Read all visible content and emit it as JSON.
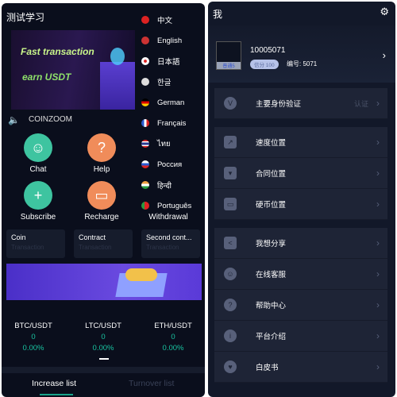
{
  "left": {
    "title": "测试学习",
    "banner": {
      "line1": "Fast transaction",
      "line2": "earn  USDT"
    },
    "notice": "COINZOOM",
    "functions": [
      {
        "label": "Chat",
        "icon": "headset-icon",
        "color": "#3ec4a0"
      },
      {
        "label": "Help",
        "icon": "question-icon",
        "color": "#f08c5a"
      },
      {
        "label": "Subscribe",
        "icon": "document-plus-icon",
        "color": "#3ec4a0"
      },
      {
        "label": "Recharge",
        "icon": "wallet-icon",
        "color": "#f08c5a"
      },
      {
        "label": "Withdrawal"
      }
    ],
    "languages": [
      {
        "label": "中文",
        "color": "#d22"
      },
      {
        "label": "English",
        "color": "#c33"
      },
      {
        "label": "日本語",
        "color": "#fff"
      },
      {
        "label": "한글",
        "color": "#ddd"
      },
      {
        "label": "German",
        "color": "#e8a000"
      },
      {
        "label": "Français",
        "color": "#2a5bd0"
      },
      {
        "label": "ไทย",
        "color": "#2a3b90"
      },
      {
        "label": "Россия",
        "color": "#2a5bd0"
      },
      {
        "label": "हिन्दी",
        "color": "#f0a040"
      },
      {
        "label": "Português",
        "color": "#2a9b40"
      }
    ],
    "cards": [
      {
        "title": "Coin",
        "sub": "Transaction"
      },
      {
        "title": "Contract",
        "sub": "Transaction"
      },
      {
        "title": "Second cont...",
        "sub": "Transaction"
      }
    ],
    "tickers": [
      {
        "pair": "BTC/USDT",
        "price": "0",
        "change": "0.00%"
      },
      {
        "pair": "LTC/USDT",
        "price": "0",
        "change": "0.00%"
      },
      {
        "pair": "ETH/USDT",
        "price": "0",
        "change": "0.00%"
      }
    ],
    "tabs": [
      "Increase list",
      "Turnover list"
    ]
  },
  "right": {
    "title": "我",
    "user": {
      "id": "10005071",
      "avatar_label": "普通5",
      "badge": "信分 100",
      "number": "编号:  5071"
    },
    "menu": [
      {
        "label": "主要身份验证",
        "extra": "认证",
        "icon": "v-badge-icon"
      },
      {
        "label": "速度位置",
        "icon": "chart-icon"
      },
      {
        "label": "合同位置",
        "icon": "bookmark-icon"
      },
      {
        "label": "硬币位置",
        "icon": "wallet-icon"
      },
      {
        "label": "我想分享",
        "icon": "share-icon"
      },
      {
        "label": "在线客服",
        "icon": "support-icon"
      },
      {
        "label": "帮助中心",
        "icon": "help-icon"
      },
      {
        "label": "平台介绍",
        "icon": "info-icon"
      },
      {
        "label": "白皮书",
        "icon": "shield-icon"
      }
    ]
  }
}
